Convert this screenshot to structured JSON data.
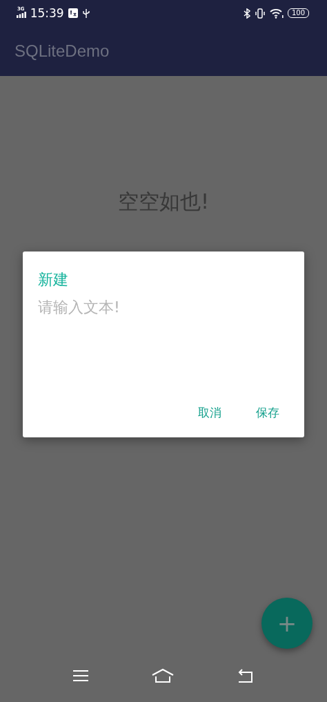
{
  "status_bar": {
    "network": "3G",
    "time": "15:39",
    "battery": "100"
  },
  "app_bar": {
    "title": "SQLiteDemo"
  },
  "empty_message": "空空如也!",
  "dialog": {
    "title": "新建",
    "input": {
      "placeholder": "请输入文本!"
    },
    "buttons": [
      "取消",
      "保存"
    ]
  },
  "fab": {
    "label": "+"
  }
}
